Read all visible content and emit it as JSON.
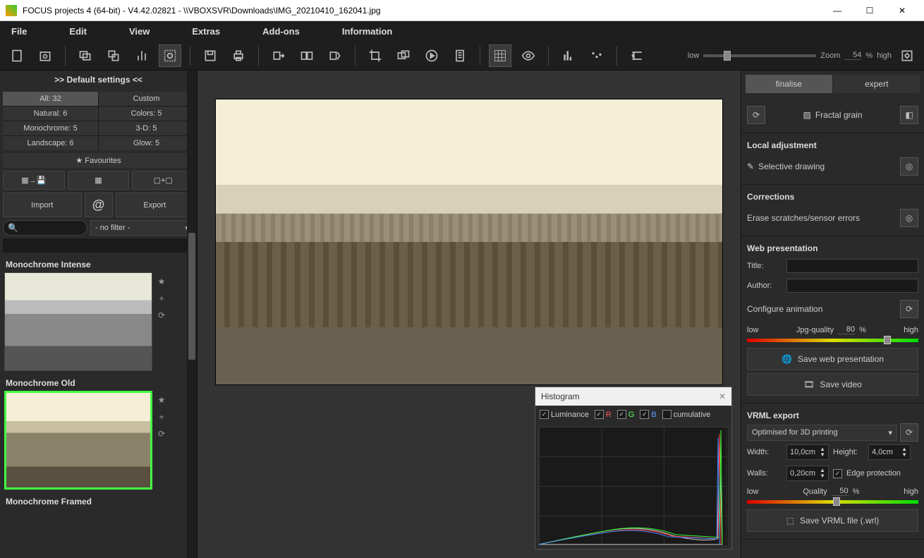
{
  "titlebar": {
    "title": "FOCUS projects 4 (64-bit) - V4.42.02821 - \\\\VBOXSVR\\Downloads\\IMG_20210410_162041.jpg"
  },
  "menu": {
    "file": "File",
    "edit": "Edit",
    "view": "View",
    "extras": "Extras",
    "addons": "Add-ons",
    "information": "Information"
  },
  "zoom": {
    "label": "Zoom",
    "value": "54",
    "pct": "%",
    "low": "low",
    "high": "high"
  },
  "left": {
    "default_settings": ">> Default settings <<",
    "cats": {
      "all": "All: 32",
      "custom": "Custom",
      "natural": "Natural: 6",
      "colors": "Colors: 5",
      "mono": "Monochrome: 5",
      "threeD": "3-D: 5",
      "landscape": "Landscape: 6",
      "glow": "Glow: 5"
    },
    "favourites": "Favourites",
    "import": "Import",
    "export": "Export",
    "filter_placeholder": "- no filter -",
    "presets": {
      "p1": "Monochrome Intense",
      "p2": "Monochrome Old",
      "p3": "Monochrome Framed"
    }
  },
  "hist": {
    "title": "Histogram",
    "lum": "Luminance",
    "r": "R",
    "g": "G",
    "b": "B",
    "cumulative": "cumulative"
  },
  "right": {
    "finalise": "finalise",
    "expert": "expert",
    "fractal_grain": "Fractal grain",
    "local_adj": "Local adjustment",
    "selective_drawing": "Selective drawing",
    "corrections": "Corrections",
    "erase": "Erase scratches/sensor errors",
    "web_pres": "Web presentation",
    "title_lbl": "Title:",
    "author_lbl": "Author:",
    "configure_anim": "Configure animation",
    "jpg_quality": "Jpg-quality",
    "jpg_val": "80",
    "pct": "%",
    "low": "low",
    "high": "high",
    "save_web": "Save web presentation",
    "save_video": "Save video",
    "vrml": "VRML export",
    "vrml_opt": "Optimised for 3D printing",
    "width_lbl": "Width:",
    "width_val": "10,0cm",
    "height_lbl": "Height:",
    "height_val": "4,0cm",
    "walls_lbl": "Walls:",
    "walls_val": "0,20cm",
    "edge_prot": "Edge protection",
    "quality": "Quality",
    "quality_val": "50",
    "save_vrml": "Save VRML file (.wrl)"
  }
}
